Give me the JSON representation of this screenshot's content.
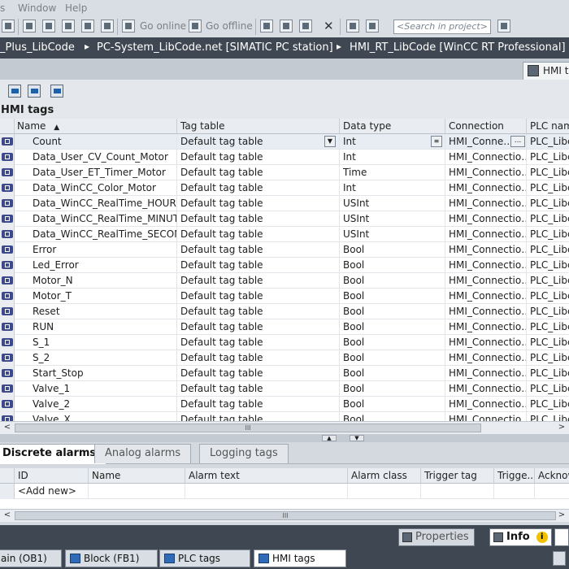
{
  "menu": {
    "items": [
      "Window",
      "Help"
    ]
  },
  "toolbar": {
    "go_online": "Go online",
    "go_offline": "Go offline",
    "search_placeholder": "<Search in project>"
  },
  "breadcrumb": {
    "items": [
      "_Plus_LibCode",
      "PC-System_LibCode.net [SIMATIC PC station]",
      "HMI_RT_LibCode [WinCC RT Professional]"
    ],
    "separator": "▸"
  },
  "editor_tab": {
    "label": "HMI tags"
  },
  "section": {
    "title": "HMI tags"
  },
  "tag_table": {
    "columns": [
      "Name",
      "Tag table",
      "Data type",
      "Connection",
      "PLC name"
    ],
    "sort_indicator": "▲",
    "rows": [
      {
        "name": "Count",
        "table": "Default tag table",
        "type": "Int",
        "conn": "HMI_Conne…",
        "plc": "PLC_Libc"
      },
      {
        "name": "Data_User_CV_Count_Motor",
        "table": "Default tag table",
        "type": "Int",
        "conn": "HMI_Connectio…",
        "plc": "PLC_Libc"
      },
      {
        "name": "Data_User_ET_Timer_Motor",
        "table": "Default tag table",
        "type": "Time",
        "conn": "HMI_Connectio…",
        "plc": "PLC_Libc"
      },
      {
        "name": "Data_WinCC_Color_Motor",
        "table": "Default tag table",
        "type": "Int",
        "conn": "HMI_Connectio…",
        "plc": "PLC_Libc"
      },
      {
        "name": "Data_WinCC_RealTime_HOUR",
        "table": "Default tag table",
        "type": "USInt",
        "conn": "HMI_Connectio…",
        "plc": "PLC_Libc"
      },
      {
        "name": "Data_WinCC_RealTime_MINUTE",
        "table": "Default tag table",
        "type": "USInt",
        "conn": "HMI_Connectio…",
        "plc": "PLC_Libc"
      },
      {
        "name": "Data_WinCC_RealTime_SECOND",
        "table": "Default tag table",
        "type": "USInt",
        "conn": "HMI_Connectio…",
        "plc": "PLC_Libc"
      },
      {
        "name": "Error",
        "table": "Default tag table",
        "type": "Bool",
        "conn": "HMI_Connectio…",
        "plc": "PLC_Libc"
      },
      {
        "name": "Led_Error",
        "table": "Default tag table",
        "type": "Bool",
        "conn": "HMI_Connectio…",
        "plc": "PLC_Libc"
      },
      {
        "name": "Motor_N",
        "table": "Default tag table",
        "type": "Bool",
        "conn": "HMI_Connectio…",
        "plc": "PLC_Libc"
      },
      {
        "name": "Motor_T",
        "table": "Default tag table",
        "type": "Bool",
        "conn": "HMI_Connectio…",
        "plc": "PLC_Libc"
      },
      {
        "name": "Reset",
        "table": "Default tag table",
        "type": "Bool",
        "conn": "HMI_Connectio…",
        "plc": "PLC_Libc"
      },
      {
        "name": "RUN",
        "table": "Default tag table",
        "type": "Bool",
        "conn": "HMI_Connectio…",
        "plc": "PLC_Libc"
      },
      {
        "name": "S_1",
        "table": "Default tag table",
        "type": "Bool",
        "conn": "HMI_Connectio…",
        "plc": "PLC_Libc"
      },
      {
        "name": "S_2",
        "table": "Default tag table",
        "type": "Bool",
        "conn": "HMI_Connectio…",
        "plc": "PLC_Libc"
      },
      {
        "name": "Start_Stop",
        "table": "Default tag table",
        "type": "Bool",
        "conn": "HMI_Connectio…",
        "plc": "PLC_Libc"
      },
      {
        "name": "Valve_1",
        "table": "Default tag table",
        "type": "Bool",
        "conn": "HMI_Connectio…",
        "plc": "PLC_Libc"
      },
      {
        "name": "Valve_2",
        "table": "Default tag table",
        "type": "Bool",
        "conn": "HMI_Connectio…",
        "plc": "PLC_Libc"
      },
      {
        "name": "Valve_X",
        "table": "Default tag table",
        "type": "Bool",
        "conn": "HMI_Connectio…",
        "plc": "PLC_Libc"
      }
    ]
  },
  "scroll": {
    "left": "<",
    "right": ">",
    "grip": "III"
  },
  "splitter": {
    "up": "▲",
    "down": "▼"
  },
  "lower_tabs": [
    "Discrete alarms",
    "Analog alarms",
    "Logging tags"
  ],
  "alarm_table": {
    "columns": [
      "ID",
      "Name",
      "Alarm text",
      "Alarm class",
      "Trigger tag",
      "Trigge..",
      "Acknow"
    ],
    "add_new": "<Add new>"
  },
  "bottom_panel": {
    "properties": "Properties",
    "info": "Info",
    "info_badge": "i"
  },
  "taskbar": {
    "items": [
      "ain (OB1)",
      "Block (FB1)",
      "PLC tags",
      "HMI tags"
    ]
  },
  "colors": {
    "dark_bar": "#3f4852",
    "tag_icon": "#3c4a8c",
    "selected_row": "#e8edf3"
  }
}
